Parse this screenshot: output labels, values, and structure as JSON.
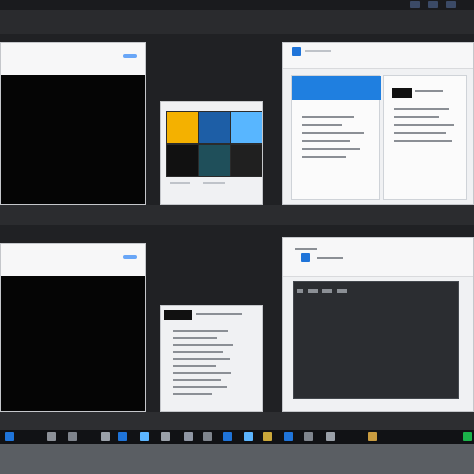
{
  "screen": {
    "top_icons": [
      "window-thumbnail-icon",
      "window-thumbnail-icon",
      "window-thumbnail-icon"
    ],
    "taskbar_icons": [
      "window-icon",
      "file-icon",
      "grid-icon",
      "settings-icon",
      "app-icon",
      "app-icon",
      "window-icon",
      "folder-icon",
      "browser-icon",
      "terminal-icon",
      "media-icon",
      "store-icon",
      "office-icon",
      "battery-icon",
      "wifi-icon",
      "volume-icon",
      "clock-icon"
    ],
    "windows": [
      {
        "name": "window-top-left",
        "kind": "browser"
      },
      {
        "name": "window-top-middle",
        "kind": "image-viewer"
      },
      {
        "name": "window-top-right",
        "kind": "document"
      },
      {
        "name": "window-bottom-left",
        "kind": "browser"
      },
      {
        "name": "window-bottom-middle",
        "kind": "text-document"
      },
      {
        "name": "window-bottom-right",
        "kind": "editor"
      }
    ]
  }
}
